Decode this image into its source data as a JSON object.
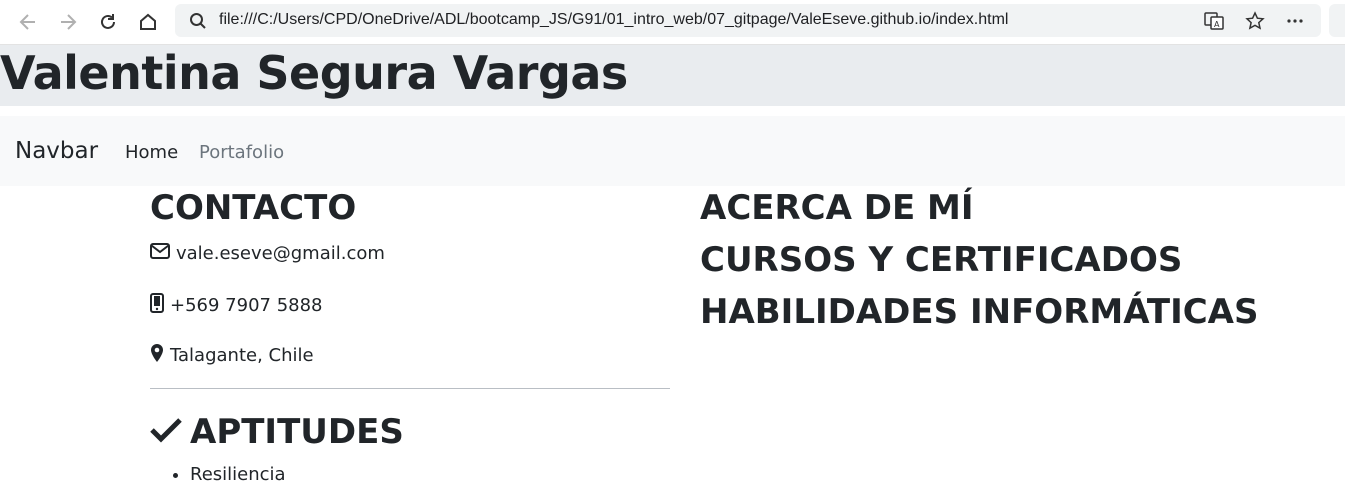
{
  "browser": {
    "url": "file:///C:/Users/CPD/OneDrive/ADL/bootcamp_JS/G91/01_intro_web/07_gitpage/ValeEseve.github.io/index.html",
    "icons": [
      "back-arrow-icon",
      "forward-arrow-icon",
      "reload-icon",
      "home-icon",
      "search-icon",
      "translate-icon",
      "star-icon",
      "more-icon"
    ]
  },
  "page": {
    "title": "Valentina Segura Vargas",
    "navbar": {
      "brand": "Navbar",
      "links": [
        "Home",
        "Portafolio"
      ]
    },
    "contact": {
      "heading": "CONTACTO",
      "email": "vale.eseve@gmail.com",
      "phone": "+569 7907 5888",
      "location": "Talagante, Chile"
    },
    "aptitudes": {
      "heading": "APTITUDES",
      "items": [
        "Resiliencia"
      ]
    },
    "right_sections": [
      "ACERCA DE MÍ",
      "CURSOS Y CERTIFICADOS",
      "HABILIDADES INFORMÁTICAS"
    ]
  },
  "colors": {
    "header_bg": "#e9ecef",
    "navbar_bg": "#f8f9fa",
    "text": "#212529",
    "muted": "#6c757d"
  }
}
